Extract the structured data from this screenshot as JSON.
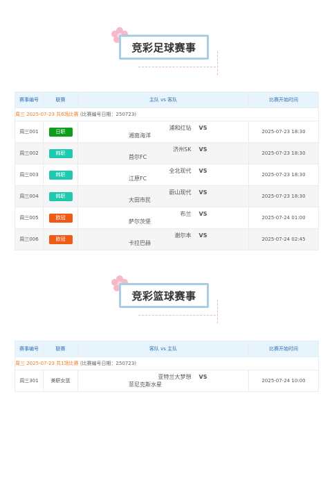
{
  "football": {
    "title": "竞彩足球赛事",
    "headers": {
      "id": "赛事编号",
      "league": "联赛",
      "teams": "主队 vs 客队",
      "time": "比赛开始时间"
    },
    "date_line": {
      "main": "周三 2025-07-23 共6场比赛",
      "sub": "(比赛编号日期：250723)"
    },
    "vs_label": "VS",
    "matches": [
      {
        "id": "周三001",
        "league": "日职",
        "league_color": "#0f9d1e",
        "home": "浦和红钻",
        "away": "湘南海洋",
        "time": "2025-07-23 18:30"
      },
      {
        "id": "周三002",
        "league": "韩职",
        "league_color": "#1ec9b0",
        "home": "济州SK",
        "away": "首尔FC",
        "time": "2025-07-23 18:30"
      },
      {
        "id": "周三003",
        "league": "韩职",
        "league_color": "#1ec9b0",
        "home": "全北现代",
        "away": "江原FC",
        "time": "2025-07-23 18:30"
      },
      {
        "id": "周三004",
        "league": "韩职",
        "league_color": "#1ec9b0",
        "home": "蔚山现代",
        "away": "大田市民",
        "time": "2025-07-23 18:30"
      },
      {
        "id": "周三005",
        "league": "欧冠",
        "league_color": "#f05a14",
        "home": "布兰",
        "away": "萨尔茨堡",
        "time": "2025-07-24 01:00"
      },
      {
        "id": "周三006",
        "league": "欧冠",
        "league_color": "#f05a14",
        "home": "谢尔本",
        "away": "卡拉巴赫",
        "time": "2025-07-24 02:45"
      }
    ]
  },
  "basketball": {
    "title": "竞彩篮球赛事",
    "headers": {
      "id": "赛事编号",
      "league": "联赛",
      "teams": "客队 vs 主队",
      "time": "比赛开始时间"
    },
    "date_line": {
      "main": "周三 2025-07-23 共1场比赛",
      "sub": "(比赛编号日期：250723)"
    },
    "vs_label": "VS",
    "matches": [
      {
        "id": "周三301",
        "league": "美职女篮",
        "away": "亚特兰大梦想",
        "home": "菲尼克斯水星",
        "time": "2025-07-24 10:00"
      }
    ]
  }
}
